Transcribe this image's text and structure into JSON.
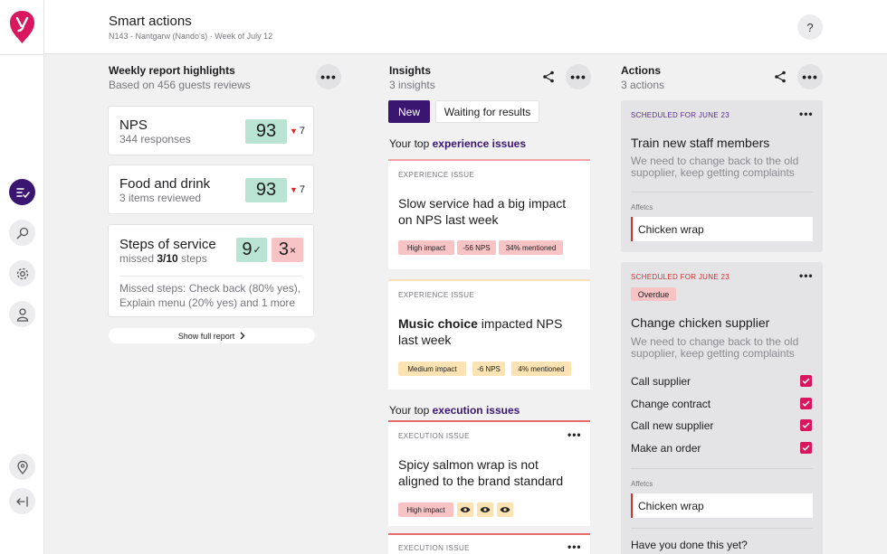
{
  "header": {
    "title": "Smart actions",
    "subtitle": "N143 - Nantgarw (Nando's) · Week of July 12",
    "help_label": "?"
  },
  "sidebar": {
    "items": [
      {
        "icon": "smart-actions-icon",
        "active": true
      },
      {
        "icon": "search-icon"
      },
      {
        "icon": "gear-icon"
      },
      {
        "icon": "user-icon"
      }
    ],
    "bottom": [
      {
        "icon": "location-pin-icon"
      },
      {
        "icon": "collapse-icon"
      }
    ]
  },
  "highlights": {
    "title": "Weekly report highlights",
    "subtitle": "Based on 456 guests reviews",
    "more_label": "•••",
    "nps": {
      "name": "NPS",
      "sub": "344 responses",
      "score": "93",
      "delta": "7"
    },
    "food": {
      "name": "Food and drink",
      "sub": "3 items reviewed",
      "score": "93",
      "delta": "7"
    },
    "steps": {
      "name": "Steps of service",
      "sub_prefix": "missed ",
      "sub_bold": "3/10",
      "sub_suffix": " steps",
      "passed": "9",
      "passed_mark": "✓",
      "failed": "3",
      "failed_mark": "×",
      "missed_text": "Missed steps: Check back (80% yes), Explain menu (20% yes) and 1 more"
    },
    "show_full": "Show full report"
  },
  "insights": {
    "title": "Insights",
    "subtitle": "3 insights",
    "more_label": "•••",
    "tabs": {
      "new": "New",
      "waiting": "Waiting for results"
    },
    "experience_label_prefix": "Your top ",
    "experience_label_bold": "experience issues",
    "execution_label_prefix": "Your top ",
    "execution_label_bold": "execution issues",
    "issues": [
      {
        "kind": "EXPERIENCE ISSUE",
        "title": "Slow service had a big impact on NPS last week",
        "tags": [
          "High impact",
          "-56 NPS",
          "34% mentioned"
        ]
      },
      {
        "kind": "EXPERIENCE ISSUE",
        "title_bold": "Music choice",
        "title_rest": " impacted NPS last week",
        "tags": [
          "Medium impact",
          "-6 NPS",
          "4% mentioned"
        ]
      },
      {
        "kind": "EXECUTION ISSUE",
        "title": "Spicy salmon wrap is not aligned to the brand standard",
        "tags": [
          "High impact"
        ],
        "dots": "•••"
      },
      {
        "kind": "EXECUTION ISSUE",
        "dots": "•••"
      }
    ]
  },
  "actions": {
    "title": "Actions",
    "subtitle": "3 actions",
    "more_label": "•••",
    "items": [
      {
        "schedule": "SCHEDULED FOR JUNE 23",
        "title": "Train new staff members",
        "desc": "We need to change back to the old supoplier, keep getting complaints",
        "affects_label": "Affetcs",
        "affects_value": "Chicken wrap",
        "dots": "•••"
      },
      {
        "schedule": "SCHEDULED FOR JUNE 23",
        "badge": "Overdue",
        "title": "Change chicken supplier",
        "desc": "We need to change back to the old supoplier, keep getting complaints",
        "tasks": [
          "Call supplier",
          "Change contract",
          "Call new supplier",
          "Make an order"
        ],
        "affects_label": "Affetcs",
        "affects_value": "Chicken wrap",
        "question": "Have you done this yet?",
        "dots": "•••"
      }
    ]
  },
  "colors": {
    "brand": "#3a1670",
    "logo": "#d8175e",
    "green": "#b9e4d4",
    "red": "#f8c3c4",
    "amber": "#fbe3b3"
  }
}
